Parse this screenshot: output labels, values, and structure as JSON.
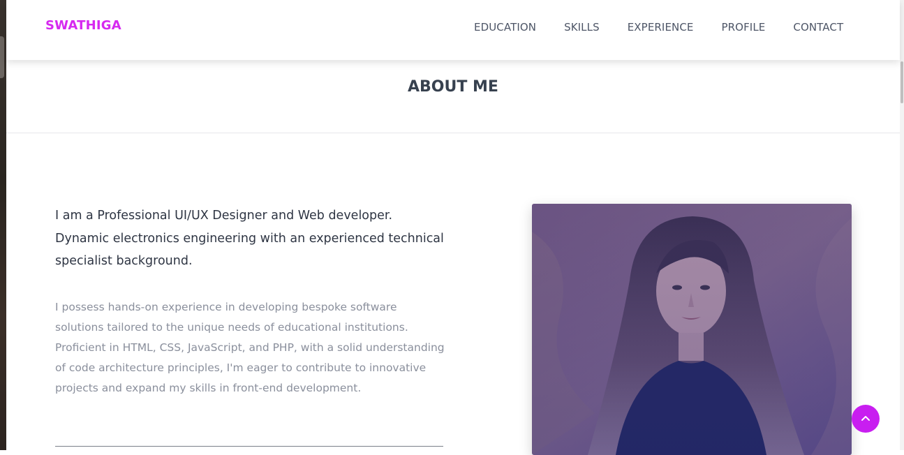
{
  "brand": {
    "logo": "SWATHIGA",
    "accent_color": "#d629f0"
  },
  "nav": {
    "items": [
      {
        "label": "EDUCATION"
      },
      {
        "label": "SKILLS"
      },
      {
        "label": "EXPERIENCE"
      },
      {
        "label": "PROFILE"
      },
      {
        "label": "CONTACT"
      }
    ]
  },
  "about": {
    "title": "ABOUT ME",
    "intro": "I am a Professional UI/UX Designer and Web developer. Dynamic electronics engineering with an experienced technical specialist background.",
    "body": "I possess hands-on experience in developing bespoke software solutions tailored to the unique needs of educational institutions. Proficient in HTML, CSS, JavaScript, and PHP, with a solid understanding of code architecture principles, I'm eager to contribute to innovative projects and expand my skills in front-end development."
  },
  "icons": {
    "scroll_top": "chevron-up-icon"
  },
  "colors": {
    "scroll_button": "#c81ef0",
    "heading": "#37414f",
    "body_text": "#8a8f9c"
  }
}
